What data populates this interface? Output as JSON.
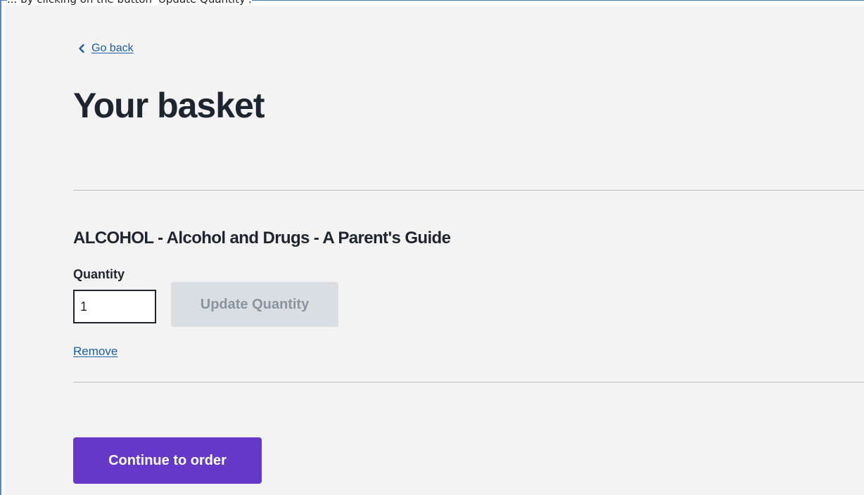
{
  "instruction": "... by clicking on the button 'Update Quantity'.",
  "header": {
    "back_link_label": "Go back",
    "title": "Your basket"
  },
  "basket": {
    "items": [
      {
        "title": "ALCOHOL - Alcohol and Drugs - A Parent's Guide",
        "quantity_label": "Quantity",
        "quantity_value": "1",
        "update_button_label": "Update Quantity",
        "remove_link_label": "Remove"
      }
    ]
  },
  "actions": {
    "continue_label": "Continue to order"
  },
  "colors": {
    "page_background": "#f3f3f3",
    "link": "#1a5fa8",
    "primary_button": "#6638c8",
    "disabled_button": "#d9dee2"
  },
  "icons": {
    "back": "chevron-left-icon"
  }
}
